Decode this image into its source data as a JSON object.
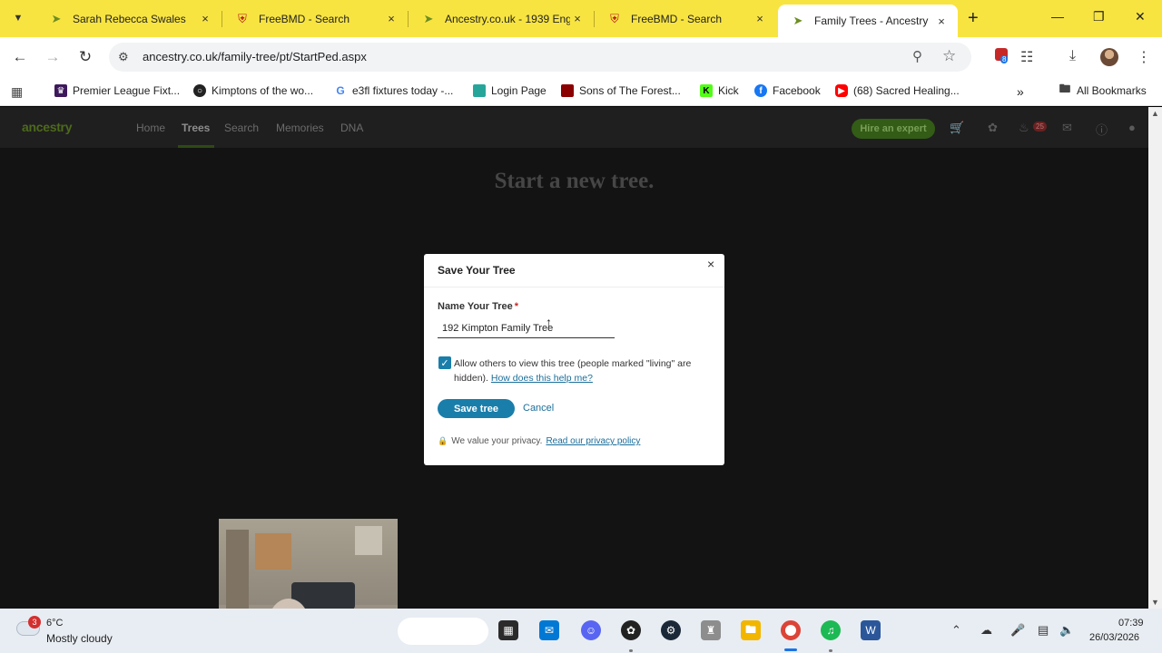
{
  "browser": {
    "tabs": [
      {
        "title": "Sarah Rebecca Swales",
        "favicon": "ancestry-leaf-icon"
      },
      {
        "title": "FreeBMD - Search",
        "favicon": "freebmd-shield-icon"
      },
      {
        "title": "Ancestry.co.uk - 1939 Eng",
        "favicon": "ancestry-leaf-icon"
      },
      {
        "title": "FreeBMD - Search",
        "favicon": "freebmd-shield-icon"
      },
      {
        "title": "Family Trees - Ancestry",
        "favicon": "ancestry-leaf-icon",
        "active": true
      }
    ],
    "close_glyph": "×",
    "new_tab_glyph": "+",
    "url": "ancestry.co.uk/family-tree/pt/StartPed.aspx",
    "extension_badge": "8",
    "bookmarks": [
      {
        "label": "Premier League Fixt...",
        "icon": "premier-league-icon",
        "color": "#3d195b"
      },
      {
        "label": "Kimptons of the wo...",
        "icon": "globe-icon",
        "color": "#222222"
      },
      {
        "label": "e3fl fixtures today -...",
        "icon": "google-icon",
        "color": "#4285f4"
      },
      {
        "label": "Login Page",
        "icon": "login-page-icon",
        "color": "#26a69a"
      },
      {
        "label": "Sons of The Forest...",
        "icon": "sons-forest-icon",
        "color": "#8b0000"
      },
      {
        "label": "Kick",
        "icon": "kick-icon",
        "color": "#1b5e20"
      },
      {
        "label": "Facebook",
        "icon": "facebook-icon",
        "color": "#1877f2"
      },
      {
        "label": "(68) Sacred Healing...",
        "icon": "youtube-icon",
        "color": "#ff0000"
      }
    ],
    "all_bookmarks": "All Bookmarks"
  },
  "site": {
    "logo": "ancestry",
    "nav": [
      {
        "label": "Home"
      },
      {
        "label": "Trees",
        "active": true
      },
      {
        "label": "Search"
      },
      {
        "label": "Memories"
      },
      {
        "label": "DNA"
      }
    ],
    "hire_button": "Hire an expert",
    "notification_count": "25",
    "page_title": "Start a new tree."
  },
  "modal": {
    "title": "Save Your Tree",
    "close_glyph": "×",
    "field_label": "Name Your Tree",
    "required_mark": "*",
    "tree_name_value": "192 Kimpton Family Tree",
    "share_checked": true,
    "share_text": "Allow others to view this tree (people marked \"living\" are hidden).",
    "help_link": "How does this help me?",
    "save_button": "Save tree",
    "cancel_link": "Cancel",
    "privacy_text": "We value your privacy.",
    "privacy_link": "Read our privacy policy"
  },
  "taskbar": {
    "weather_badge": "3",
    "temperature": "6°C",
    "condition": "Mostly cloudy",
    "time": "07:39",
    "date": "26/03/2026"
  }
}
